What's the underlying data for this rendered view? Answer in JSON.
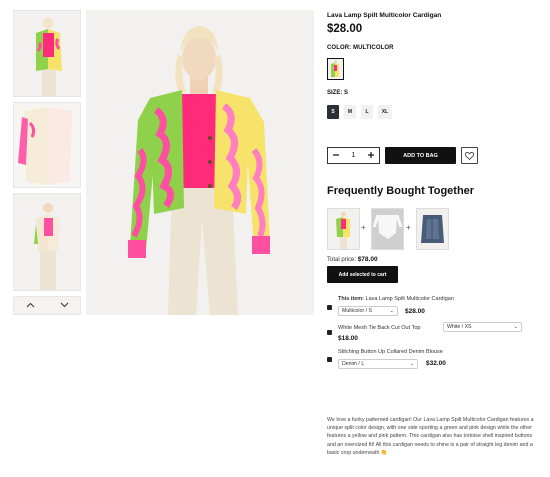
{
  "product": {
    "title": "Lava Lamp Spilt Multicolor Cardigan",
    "price": "$28.00",
    "color_label": "COLOR: MULTICOLOR",
    "size_label": "SIZE: S",
    "sizes": [
      "S",
      "M",
      "L",
      "XL"
    ],
    "selected_size": "S",
    "quantity": "1",
    "add_to_bag": "ADD TO BAG"
  },
  "gallery": {
    "prev_icon": "chevron-up-icon",
    "next_icon": "chevron-down-icon"
  },
  "fbt": {
    "title": "Frequently Bought Together",
    "total_label": "Total price:",
    "total_value": "$78.00",
    "add_selected": "Add selected to cart",
    "items": [
      {
        "prefix": "This item:",
        "name": "Lava Lamp Spilt Multicolor Cardigan",
        "variant": "Multicolor / S",
        "price": "$28.00"
      },
      {
        "prefix": "",
        "name": "White Mesh Tie Back Cut Out Top",
        "variant": "White / XS",
        "price": "$18.00"
      },
      {
        "prefix": "",
        "name": "Stitching Button Up Collared Denim Blouse",
        "variant": "Denim / L",
        "price": "$32.00"
      }
    ]
  },
  "description": "We love a funky patterned cardigan! Our Lava Lamp Spilt Multicolor Cardigan features a unique split color design, with one side sporting a green and pink design while the other features a yellow and pink pattern. This cardigan also has tortoise shell inspired buttons and an oversized fit! All this cardigan needs to shine is a pair of straight leg denim and a basic crop underneath 👏",
  "colors": {
    "green": "#8fd14a",
    "pink": "#ff4fa0",
    "yellow": "#f7e36a",
    "hot_pink": "#ff2a7a",
    "cream": "#ece3d2",
    "dark": "#111111"
  }
}
